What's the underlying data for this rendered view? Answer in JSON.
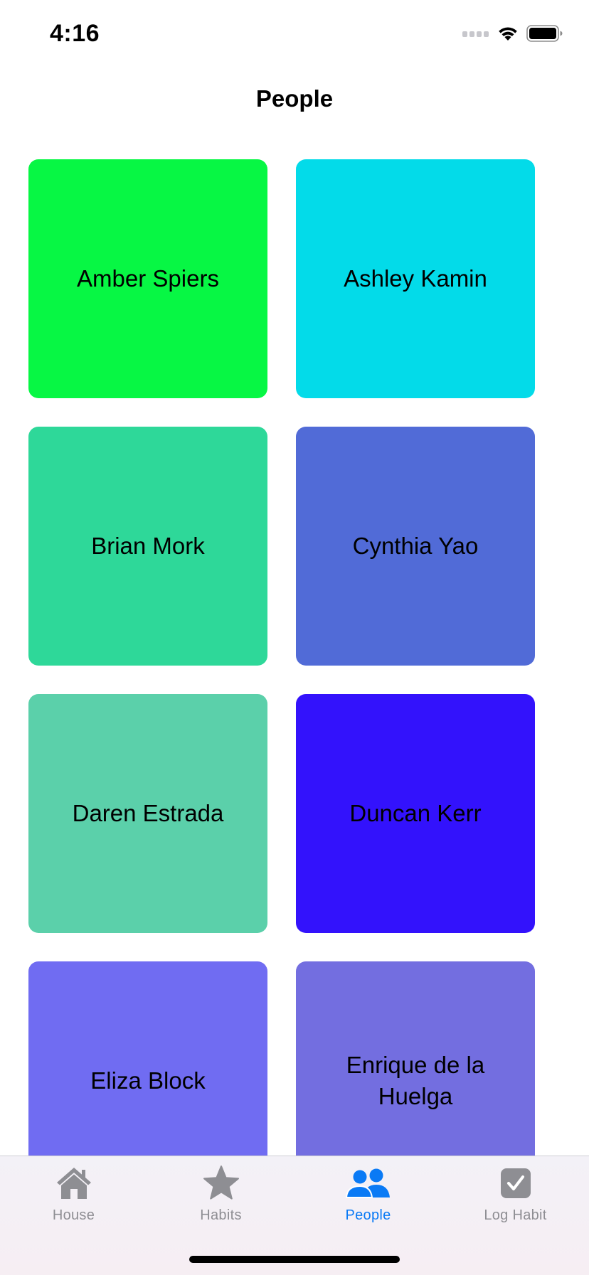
{
  "status_bar": {
    "time": "4:16",
    "icons": [
      "cellular-signal-icon",
      "wifi-icon",
      "battery-icon"
    ]
  },
  "nav": {
    "title": "People"
  },
  "people": [
    {
      "name": "Amber Spiers",
      "color": "#07f744"
    },
    {
      "name": "Ashley Kamin",
      "color": "#03dbe9"
    },
    {
      "name": "Brian Mork",
      "color": "#2ed899"
    },
    {
      "name": "Cynthia Yao",
      "color": "#516bd7"
    },
    {
      "name": "Daren Estrada",
      "color": "#5bd0aa"
    },
    {
      "name": "Duncan Kerr",
      "color": "#3312fc"
    },
    {
      "name": "Eliza Block",
      "color": "#706cf2"
    },
    {
      "name": "Enrique de la Huelga",
      "color": "#736ee0"
    }
  ],
  "tab_bar": {
    "tabs": [
      {
        "label": "House",
        "icon": "house-icon",
        "active": false
      },
      {
        "label": "Habits",
        "icon": "star-icon",
        "active": false
      },
      {
        "label": "People",
        "icon": "people-icon",
        "active": true
      },
      {
        "label": "Log Habit",
        "icon": "checkbox-icon",
        "active": false
      }
    ],
    "active_color": "#0a7af5",
    "inactive_color": "#8e8e93"
  }
}
